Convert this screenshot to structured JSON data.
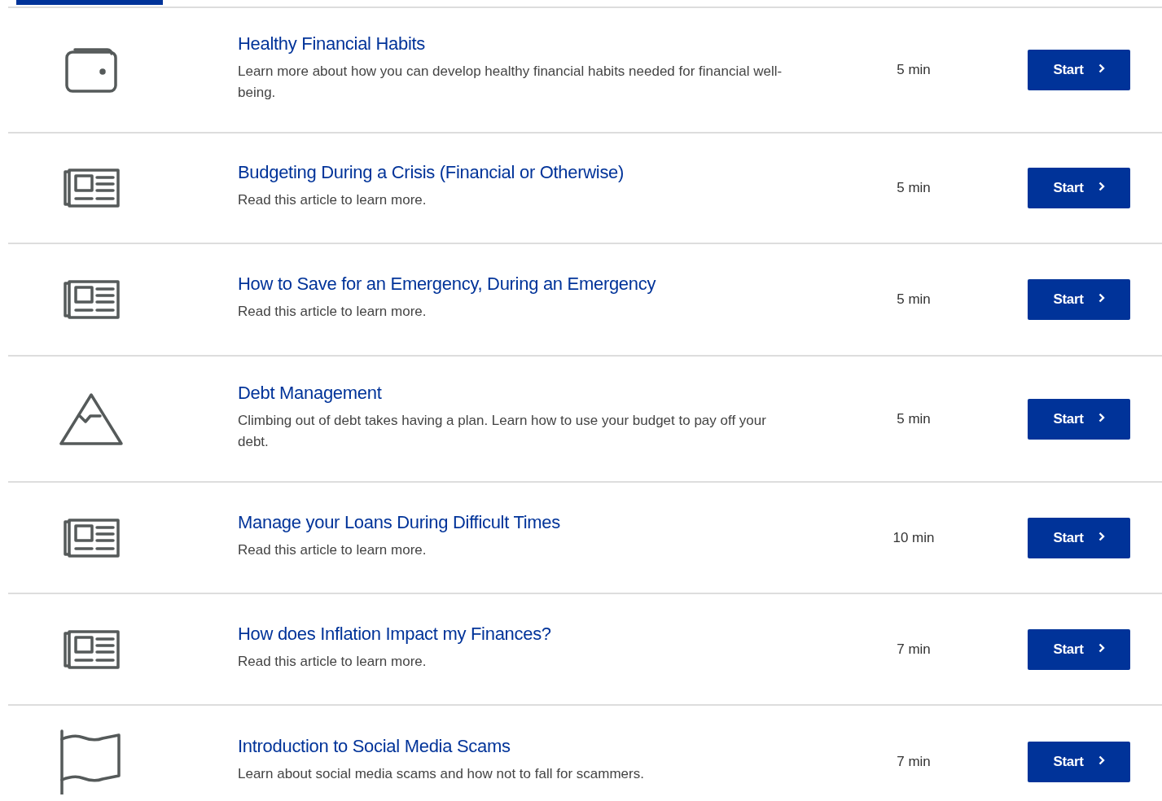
{
  "tab_indicator": {
    "selected": true
  },
  "items": [
    {
      "kind": "wallet",
      "title": "Healthy Financial Habits",
      "description": "Learn more about how you can develop healthy financial habits needed for financial well-being.",
      "duration": "5 min",
      "button": "Start"
    },
    {
      "kind": "newspaper",
      "title": "Budgeting During a Crisis (Financial or Otherwise)",
      "description": "Read this article to learn more.",
      "duration": "5 min",
      "button": "Start"
    },
    {
      "kind": "newspaper",
      "title": "How to Save for an Emergency, During an Emergency",
      "description": "Read this article to learn more.",
      "duration": "5 min",
      "button": "Start"
    },
    {
      "kind": "mountain",
      "title": "Debt Management",
      "description": "Climbing out of debt takes having a plan. Learn how to use your budget to pay off your debt.",
      "duration": "5 min",
      "button": "Start"
    },
    {
      "kind": "newspaper",
      "title": "Manage your Loans During Difficult Times",
      "description": "Read this article to learn more.",
      "duration": "10 min",
      "button": "Start"
    },
    {
      "kind": "newspaper",
      "title": "How does Inflation Impact my Finances?",
      "description": "Read this article to learn more.",
      "duration": "7 min",
      "button": "Start"
    },
    {
      "kind": "flag",
      "title": "Introduction to Social Media Scams",
      "description": "Learn about social media scams and how not to fall for scammers.",
      "duration": "7 min",
      "button": "Start"
    }
  ]
}
